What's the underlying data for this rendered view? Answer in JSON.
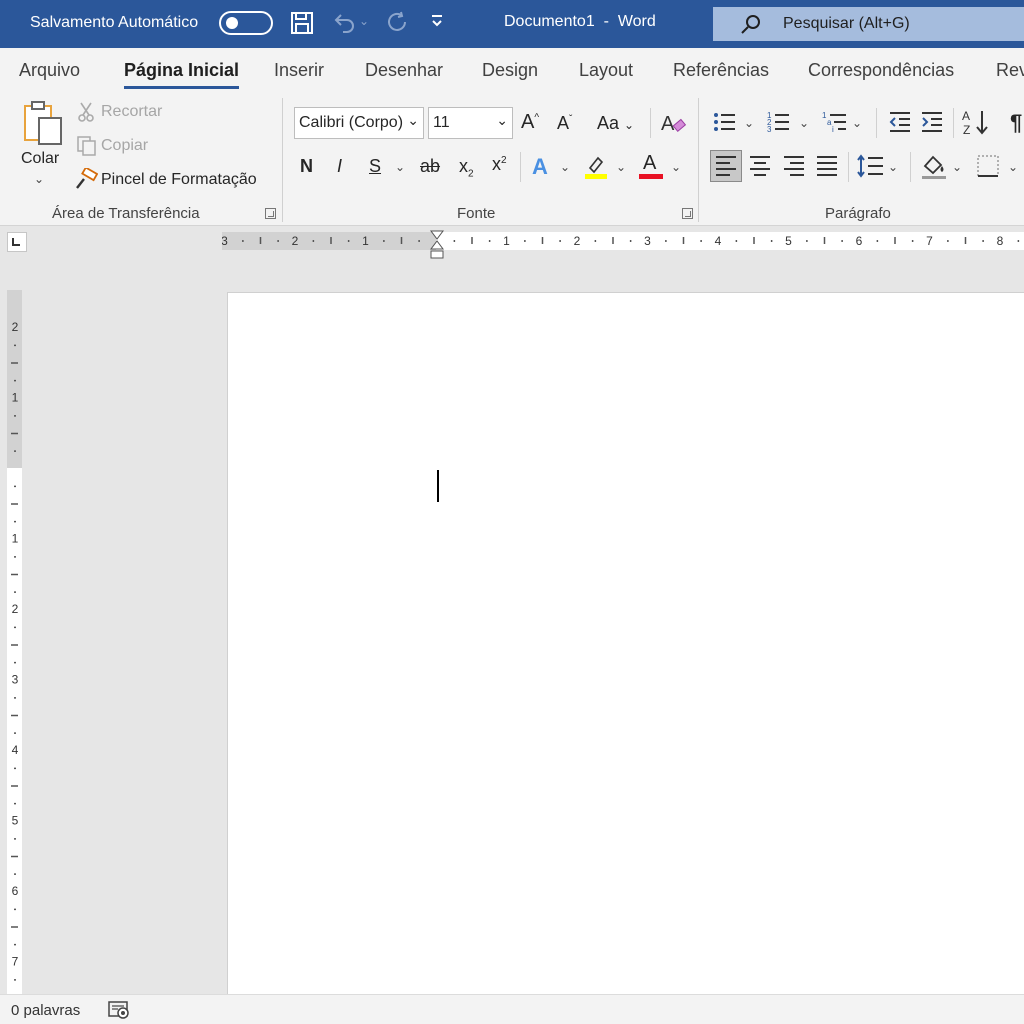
{
  "titlebar": {
    "autosave_label": "Salvamento Automático",
    "document_title": "Documento1  -  Word",
    "search_placeholder": "Pesquisar (Alt+G)",
    "brand_color": "#2b579a"
  },
  "tabs": [
    "Arquivo",
    "Página Inicial",
    "Inserir",
    "Desenhar",
    "Design",
    "Layout",
    "Referências",
    "Correspondências",
    "Rev"
  ],
  "active_tab": "Página Inicial",
  "clipboard": {
    "paste_label": "Colar",
    "cut_label": "Recortar",
    "copy_label": "Copiar",
    "format_painter_label": "Pincel de Formatação",
    "group_label": "Área de Transferência"
  },
  "font": {
    "font_name": "Calibri (Corpo)",
    "font_size": "11",
    "grow_label": "A",
    "shrink_label": "A",
    "case_label": "Aa",
    "bold": "N",
    "italic": "I",
    "underline": "S",
    "strike": "ab",
    "sub": "x",
    "sup": "x",
    "text_effects": "A",
    "font_color": "A",
    "group_label": "Fonte",
    "highlight_color": "#ffff00",
    "font_color_value": "#e81123"
  },
  "paragraph": {
    "group_label": "Parágrafo"
  },
  "ruler": {
    "h_left_labels": [
      "3",
      "2",
      "1"
    ],
    "h_right_labels": [
      "1",
      "2",
      "3",
      "4",
      "5",
      "6",
      "7",
      "8"
    ],
    "v_top_labels": [
      "2",
      "1"
    ],
    "v_labels": [
      "1",
      "2",
      "3",
      "4",
      "5",
      "6",
      "7"
    ]
  },
  "statusbar": {
    "word_count": "0 palavras"
  }
}
